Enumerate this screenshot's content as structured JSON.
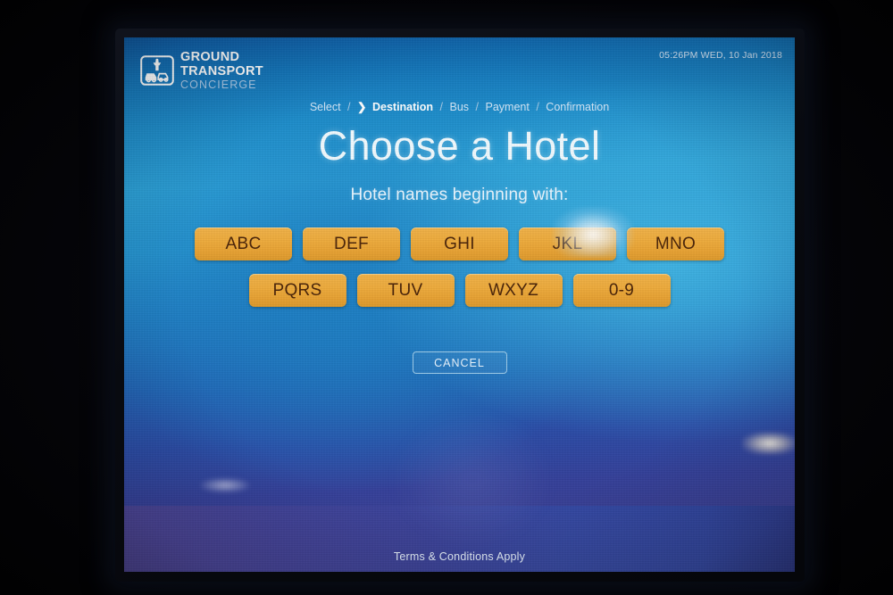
{
  "header": {
    "logo": {
      "icon": "ground-transport-badge-icon",
      "line1": "GROUND",
      "line2": "TRANSPORT",
      "line3": "CONCIERGE"
    },
    "datetime": "05:26PM WED, 10 Jan 2018"
  },
  "breadcrumb": {
    "chevron": "❯",
    "separator": "/",
    "steps": [
      {
        "label": "Select",
        "active": false
      },
      {
        "label": "Destination",
        "active": true
      },
      {
        "label": "Bus",
        "active": false
      },
      {
        "label": "Payment",
        "active": false
      },
      {
        "label": "Confirmation",
        "active": false
      }
    ]
  },
  "main": {
    "title": "Choose a Hotel",
    "subtitle": "Hotel names beginning with:",
    "letter_groups_row1": [
      "ABC",
      "DEF",
      "GHI",
      "JKL",
      "MNO"
    ],
    "letter_groups_row2": [
      "PQRS",
      "TUV",
      "WXYZ",
      "0-9"
    ],
    "cancel_label": "CANCEL"
  },
  "footer": {
    "terms": "Terms & Conditions Apply"
  },
  "colors": {
    "button_amber": "#eeab3c",
    "button_text": "#4a2408",
    "screen_blue_top": "#0d5ba5",
    "screen_blue_mid": "#2a9fd6",
    "screen_purple_bottom": "#3d3f8e",
    "text_light": "#eaf6ff"
  }
}
